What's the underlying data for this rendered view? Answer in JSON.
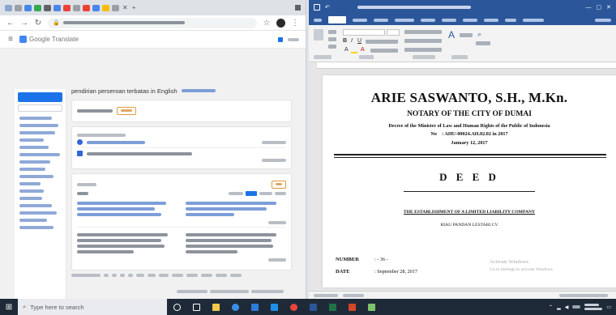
{
  "browser": {
    "title": "Google Translate",
    "translate_heading": "pendirian perseroan terbatas in English"
  },
  "word": {
    "document": {
      "notary_name": "ARIE SASWANTO, S.H., M.Kn.",
      "notary_city": "NOTARY OF THE CITY OF DUMAI",
      "decree": "Decree of the Minister of Law and Human Rights of the Public of Indonesia",
      "decree_no_label": "No",
      "decree_no_value": ": AHU-00024.AH.02.02 in 2017",
      "decree_date": "January 12, 2017",
      "deed_title": "D E E D",
      "establishment_line": "THE ESTABLISHMENT OF A LIMITED LIABILITY COMPANY",
      "company_line": "RIAU PANDAN LESTARI CV",
      "number_label": "NUMBER",
      "number_value": ": - 36 -",
      "date_label": "DATE",
      "date_value": ": September 28, 2017",
      "watermark_line1": "Activate Windows",
      "watermark_line2": "Go to Settings to activate Windows."
    }
  },
  "taskbar": {
    "search_placeholder": "Type here to search"
  },
  "colors": {
    "word_blue": "#2b579a",
    "google_blue": "#1a73e8",
    "taskbar": "#1f2a38"
  }
}
